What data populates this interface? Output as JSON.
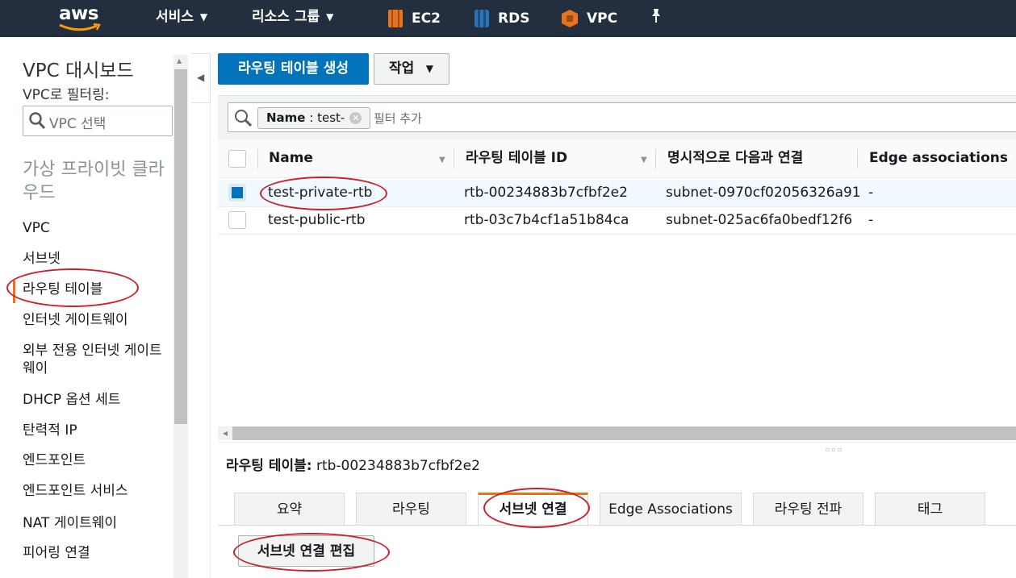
{
  "topnav": {
    "logo_text": "aws",
    "services_label": "서비스",
    "resource_groups_label": "리소스 그룹",
    "shortcuts": [
      {
        "label": "EC2",
        "icon": "ec2-icon",
        "color": "#e8731f"
      },
      {
        "label": "RDS",
        "icon": "rds-icon",
        "color": "#2e73b8"
      },
      {
        "label": "VPC",
        "icon": "vpc-icon",
        "color": "#e8731f"
      }
    ],
    "pin_icon": "pin-icon"
  },
  "sidebar": {
    "title": "VPC 대시보드",
    "filter_label": "VPC로 필터링:",
    "filter_placeholder": "VPC 선택",
    "section_title": "가상 프라이빗 클라우드",
    "items": [
      {
        "label": "VPC"
      },
      {
        "label": "서브넷"
      },
      {
        "label": "라우팅 테이블",
        "active": true
      },
      {
        "label": "인터넷 게이트웨이"
      },
      {
        "label": "외부 전용 인터넷 게이트웨이"
      },
      {
        "label": "DHCP 옵션 세트"
      },
      {
        "label": "탄력적 IP"
      },
      {
        "label": "엔드포인트"
      },
      {
        "label": "엔드포인트 서비스"
      },
      {
        "label": "NAT 게이트웨이"
      },
      {
        "label": "피어링 연결"
      }
    ]
  },
  "toolbar": {
    "create_label": "라우팅 테이블 생성",
    "actions_label": "작업"
  },
  "filter": {
    "token_key": "Name",
    "token_value": "test-",
    "add_placeholder": "필터 추가"
  },
  "table": {
    "headers": [
      "Name",
      "라우팅 테이블 ID",
      "명시적으로 다음과 연결",
      "Edge associations"
    ],
    "rows": [
      {
        "name": "test-private-rtb",
        "id": "rtb-00234883b7cfbf2e2",
        "subnet": "subnet-0970cf02056326a91",
        "edge": "-",
        "selected": true
      },
      {
        "name": "test-public-rtb",
        "id": "rtb-03c7b4cf1a51b84ca",
        "subnet": "subnet-025ac6fa0bedf12f6",
        "edge": "-",
        "selected": false
      }
    ]
  },
  "detail": {
    "label": "라우팅 테이블:",
    "value": "rtb-00234883b7cfbf2e2",
    "tabs": [
      "요약",
      "라우팅",
      "서브넷 연결",
      "Edge Associations",
      "라우팅 전파",
      "태그"
    ],
    "active_tab": "서브넷 연결",
    "edit_button": "서브넷 연결 편집"
  },
  "colors": {
    "nav_bg": "#232f3e",
    "primary": "#0073bb",
    "accent": "#ec7211",
    "annotation": "#cc1f2b"
  }
}
